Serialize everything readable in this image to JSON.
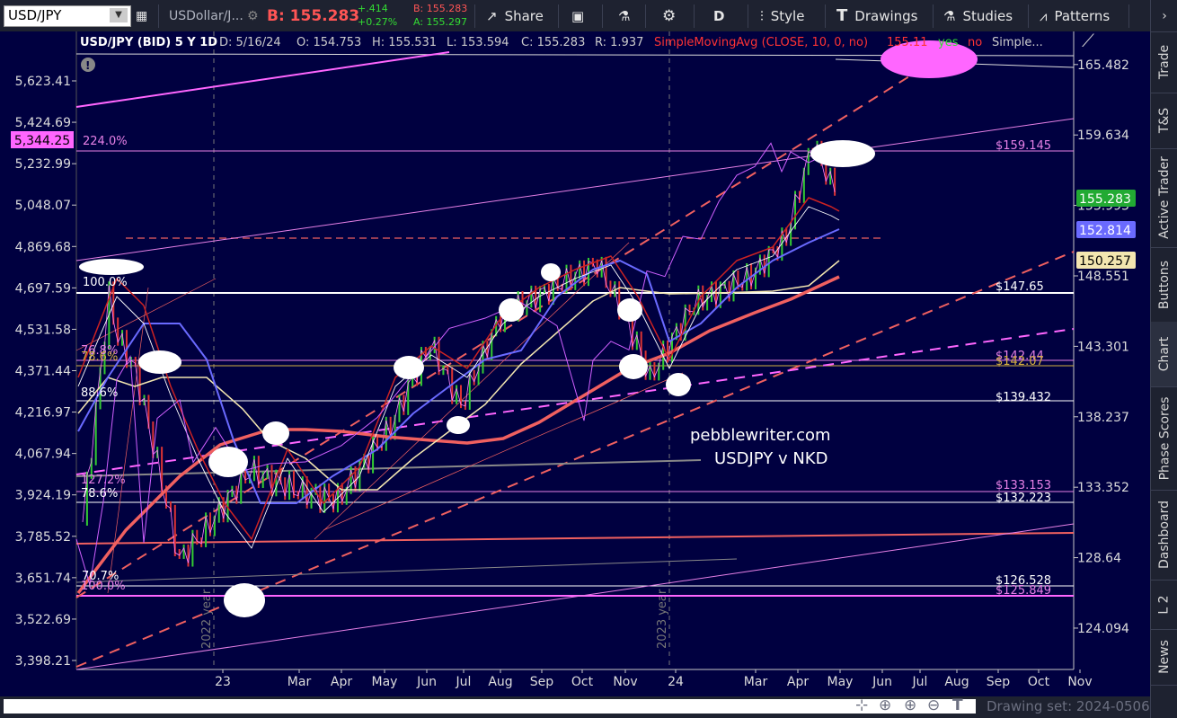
{
  "toolbar": {
    "symbol": "USD/JPY",
    "description": "USDollar/J...",
    "bid_label": "B: 155.283",
    "change": "+.414",
    "change_pct": "+0.27%",
    "bid_small": "B: 155.283",
    "ask_small": "A: 155.297",
    "share": "Share",
    "period": "D",
    "style": "Style",
    "drawings": "Drawings",
    "studies": "Studies",
    "patterns": "Patterns"
  },
  "header": {
    "title": "USD/JPY (BID) 5 Y 1D",
    "date": "D: 5/16/24",
    "open": "O: 154.753",
    "high": "H: 155.531",
    "low": "L: 153.594",
    "close": "C: 155.283",
    "range": "R: 1.937",
    "study": "SimpleMovingAvg (CLOSE, 10, 0, no)",
    "study_val": "155.11",
    "study_yes": "yes",
    "study_no": "no",
    "study_more": "Simple..."
  },
  "sidebar": [
    "Trade",
    "T&S",
    "Active Trader",
    "Buttons",
    "Chart",
    "Phase Scores",
    "Dashboard",
    "L 2",
    "News"
  ],
  "bottom": {
    "drawing_set": "Drawing set: 2024-0506"
  },
  "colors": {
    "bg": "#000040",
    "pink": "#ff66ff",
    "salmon": "#f06060",
    "blue": "#6a6aff",
    "cream": "#f3e6b0"
  },
  "chart_data": {
    "type": "line",
    "x_ticks": [
      "23",
      "Mar",
      "Apr",
      "May",
      "Jun",
      "Jul",
      "Aug",
      "Sep",
      "Oct",
      "Nov",
      "24",
      "Mar",
      "Apr",
      "May",
      "Jun",
      "Jul",
      "Aug",
      "Sep",
      "Oct",
      "Nov"
    ],
    "right_axis": {
      "ticks": [
        "165.482",
        "159.634",
        "153.993",
        "148.551",
        "143.301",
        "138.237",
        "133.352",
        "128.64",
        "124.094"
      ],
      "ylim": [
        121.5,
        168.3
      ]
    },
    "left_axis": {
      "ticks": [
        "5,623.41",
        "5,424.69",
        "5,232.99",
        "5,048.07",
        "4,869.68",
        "4,697.59",
        "4,531.58",
        "4,371.44",
        "4,216.97",
        "4,067.94",
        "3,924.19",
        "3,785.52",
        "3,651.74",
        "3,522.69",
        "3,398.21"
      ],
      "highlight": "5,344.25"
    },
    "price_badges": [
      {
        "label": "155.283",
        "color": "#22aa33"
      },
      {
        "label": "152.814",
        "color": "#6a6aff"
      },
      {
        "label": "150.257",
        "color": "#f3e6b0"
      }
    ],
    "level_labels": [
      {
        "text": "$159.145",
        "value": 159.145
      },
      {
        "text": "$147.65",
        "value": 147.65
      },
      {
        "text": "$142.44",
        "value": 142.44
      },
      {
        "text": "$142.07",
        "value": 142.07
      },
      {
        "text": "$139.432",
        "value": 139.432
      },
      {
        "text": "$133.153",
        "value": 133.153
      },
      {
        "text": "$132.223",
        "value": 132.223
      },
      {
        "text": "$126.528",
        "value": 126.528
      },
      {
        "text": "$125.849",
        "value": 125.849
      }
    ],
    "fib_labels": [
      "224.0%",
      "100.0%",
      "76.8%",
      "78.6%",
      "88.6%",
      "127.2%",
      "78.6%",
      "70.7%",
      "100.0%"
    ],
    "annotations": [
      "pebblewriter.com",
      "USDJPY v NKD"
    ],
    "year_labels": [
      "2022 year",
      "2023 year"
    ],
    "series": [
      {
        "name": "USD/JPY",
        "values": [
          [
            0,
            131.0
          ],
          [
            3,
            138.5
          ],
          [
            6,
            147.0
          ],
          [
            8,
            144.0
          ],
          [
            12,
            141.5
          ],
          [
            17,
            135.0
          ],
          [
            22,
            128.5
          ],
          [
            28,
            130.5
          ],
          [
            38,
            134.5
          ],
          [
            50,
            133.0
          ],
          [
            58,
            132.5
          ],
          [
            70,
            137.5
          ],
          [
            79,
            143.5
          ],
          [
            86,
            139.0
          ],
          [
            95,
            145.5
          ],
          [
            106,
            147.5
          ],
          [
            117,
            149.5
          ],
          [
            121,
            147.0
          ],
          [
            126,
            143.5
          ],
          [
            129,
            141.0
          ],
          [
            139,
            146.5
          ],
          [
            152,
            148.5
          ],
          [
            160,
            151.5
          ],
          [
            166,
            159.0
          ],
          [
            170,
            155.8
          ],
          [
            172,
            155.3
          ]
        ]
      }
    ]
  }
}
